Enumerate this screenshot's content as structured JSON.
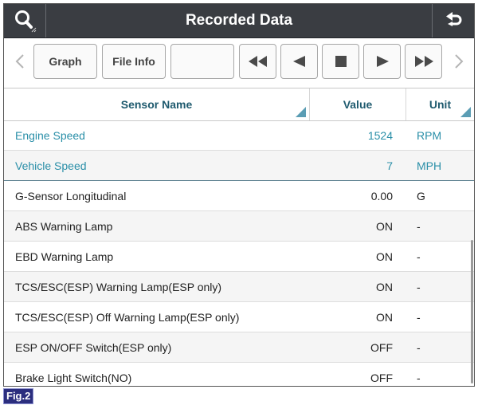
{
  "app": {
    "title": "Recorded Data",
    "icons": {
      "search": "magnifier-icon",
      "back": "return-arrow-icon"
    }
  },
  "toolbar": {
    "graph_label": "Graph",
    "file_info_label": "File Info",
    "blank_label": "",
    "icons": [
      "chevron-left-icon",
      "rewind-icon",
      "step-back-icon",
      "stop-icon",
      "play-icon",
      "fast-forward-icon",
      "chevron-right-icon"
    ]
  },
  "table": {
    "headers": {
      "name": "Sensor Name",
      "value": "Value",
      "unit": "Unit"
    },
    "rows": [
      {
        "name": "Engine Speed",
        "value": "1524",
        "unit": "RPM"
      },
      {
        "name": "Vehicle Speed",
        "value": "7",
        "unit": "MPH"
      },
      {
        "name": "G-Sensor Longitudinal",
        "value": "0.00",
        "unit": "G"
      },
      {
        "name": "ABS Warning Lamp",
        "value": "ON",
        "unit": "-"
      },
      {
        "name": "EBD Warning Lamp",
        "value": "ON",
        "unit": "-"
      },
      {
        "name": "TCS/ESC(ESP) Warning Lamp(ESP only)",
        "value": "ON",
        "unit": "-"
      },
      {
        "name": "TCS/ESC(ESP) Off Warning Lamp(ESP only)",
        "value": "ON",
        "unit": "-"
      },
      {
        "name": "ESP ON/OFF Switch(ESP only)",
        "value": "OFF",
        "unit": "-"
      },
      {
        "name": "Brake Light Switch(NO)",
        "value": "OFF",
        "unit": "-"
      }
    ]
  },
  "figure_label": "Fig.2",
  "colors": {
    "titlebar": "#3a3d42",
    "selected_text": "#2a8fa8",
    "header_text": "#1e5a6e",
    "sort_indicator": "#5b9db4",
    "fig_badge": "#2b2e7e"
  }
}
